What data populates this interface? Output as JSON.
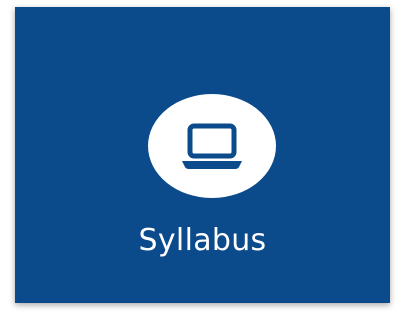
{
  "tile": {
    "label": "Syllabus",
    "icon": "laptop-icon",
    "colors": {
      "background": "#0b4a8b",
      "icon_circle": "#ffffff",
      "icon": "#0b4a8b",
      "label": "#ffffff"
    }
  }
}
